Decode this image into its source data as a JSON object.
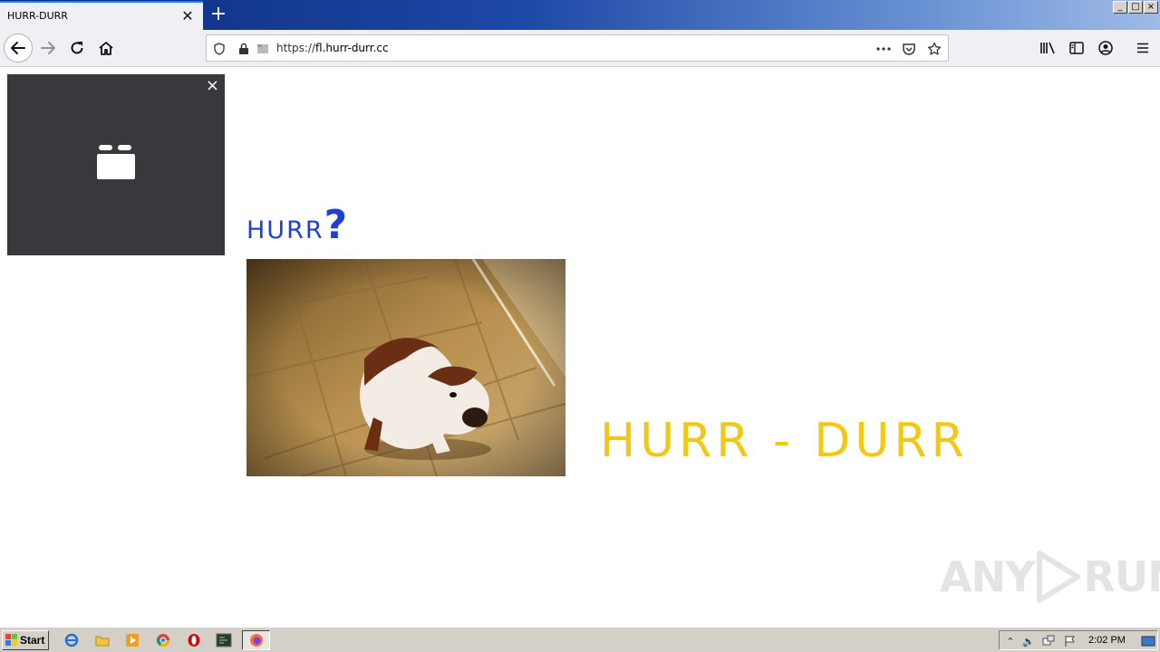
{
  "browser": {
    "tab_title": "HURR-DURR",
    "tab_close_icon": "close-icon",
    "new_tab_icon": "plus-icon",
    "url_prefix": "https://",
    "url_host": "fl.hurr-durr.cc",
    "window_controls": [
      "_",
      "□",
      "×"
    ]
  },
  "page": {
    "video_close": "×",
    "hurr_word": "HURR",
    "hurr_question": "?",
    "headline": "HURR - DURR",
    "watermark_left": "ANY",
    "watermark_right": "RUN",
    "colors": {
      "hurr_blue": "#1f3fd8",
      "headline_yellow": "#f4c811",
      "video_panel_bg": "#38383d"
    }
  },
  "taskbar": {
    "start_label": "Start",
    "clock": "2:02 PM"
  }
}
